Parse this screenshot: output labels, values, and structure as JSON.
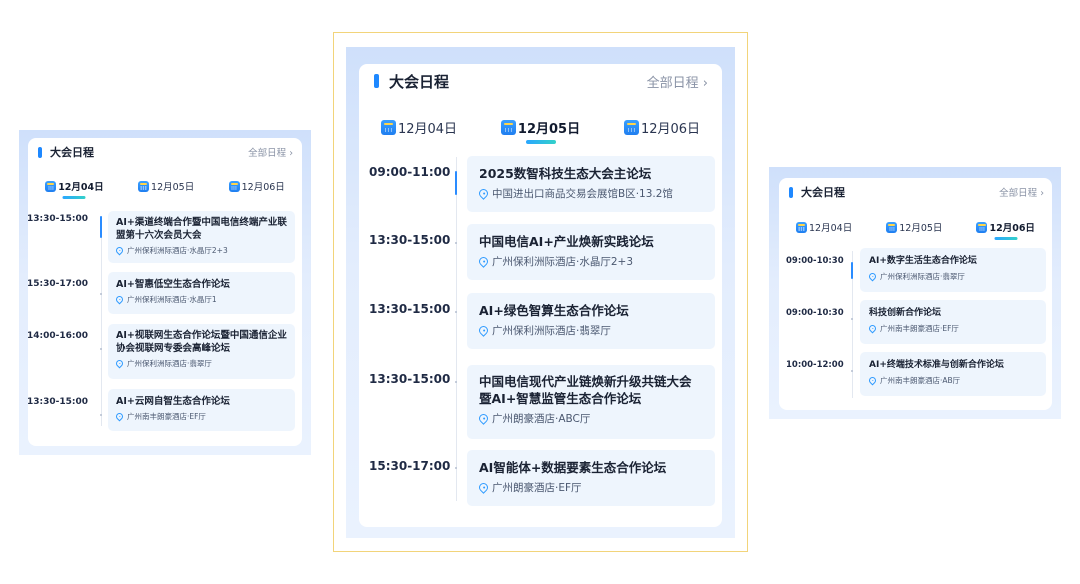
{
  "left": {
    "title": "大会日程",
    "more": "全部日程",
    "tabs": [
      "12月04日",
      "12月05日",
      "12月06日"
    ],
    "active_tab": 0,
    "sessions": [
      {
        "time": "13:30-15:00",
        "title": "AI+渠道终端合作暨中国电信终端产业联盟第十六次会员大会",
        "location": "广州保利洲际酒店·水晶厅2+3"
      },
      {
        "time": "15:30-17:00",
        "title": "AI+智惠低空生态合作论坛",
        "location": "广州保利洲际酒店·水晶厅1"
      },
      {
        "time": "14:00-16:00",
        "title": "AI+视联网生态合作论坛暨中国通信企业协会视联网专委会高峰论坛",
        "location": "广州保利洲际酒店·翡翠厅"
      },
      {
        "time": "13:30-15:00",
        "title": "AI+云网自智生态合作论坛",
        "location": "广州南丰朗豪酒店·EF厅"
      }
    ]
  },
  "center": {
    "title": "大会日程",
    "more": "全部日程",
    "tabs": [
      "12月04日",
      "12月05日",
      "12月06日"
    ],
    "active_tab": 1,
    "sessions": [
      {
        "time": "09:00-11:00",
        "title": "2025数智科技生态大会主论坛",
        "location": "中国进出口商品交易会展馆B区·13.2馆"
      },
      {
        "time": "13:30-15:00",
        "title": "中国电信AI+产业焕新实践论坛",
        "location": "广州保利洲际酒店·水晶厅2+3"
      },
      {
        "time": "13:30-15:00",
        "title": "AI+绿色智算生态合作论坛",
        "location": "广州保利洲际酒店·翡翠厅"
      },
      {
        "time": "13:30-15:00",
        "title": "中国电信现代产业链焕新升级共链大会暨AI+智慧监管生态合作论坛",
        "location": "广州朗豪酒店·ABC厅"
      },
      {
        "time": "15:30-17:00",
        "title": "AI智能体+数据要素生态合作论坛",
        "location": "广州朗豪酒店·EF厅"
      }
    ]
  },
  "right": {
    "title": "大会日程",
    "more": "全部日程",
    "tabs": [
      "12月04日",
      "12月05日",
      "12月06日"
    ],
    "active_tab": 2,
    "sessions": [
      {
        "time": "09:00-10:30",
        "title": "AI+数字生活生态合作论坛",
        "location": "广州保利洲际酒店·翡翠厅"
      },
      {
        "time": "09:00-10:30",
        "title": "科技创新合作论坛",
        "location": "广州南丰朗豪酒店·EF厅"
      },
      {
        "time": "10:00-12:00",
        "title": "AI+终端技术标准与创新合作论坛",
        "location": "广州南丰朗豪酒店·AB厅"
      }
    ]
  }
}
